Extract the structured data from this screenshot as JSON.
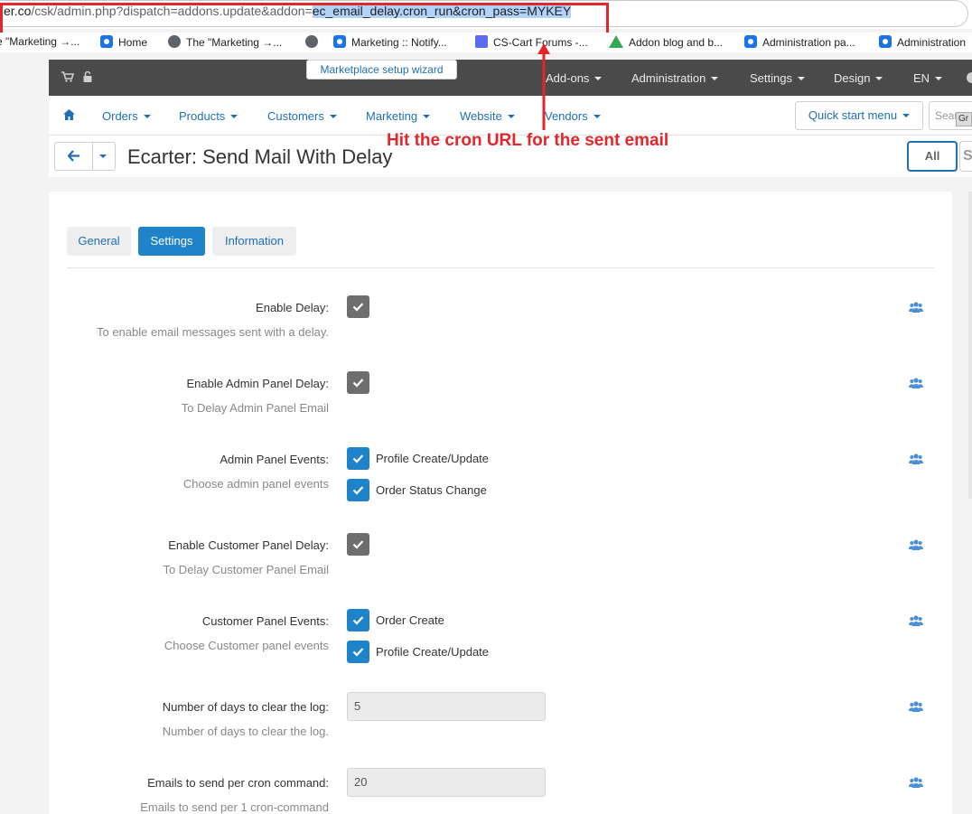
{
  "browser": {
    "url_prefix": "er.co",
    "url_path": "/csk/admin.php?dispatch=addons.update&addon=",
    "url_selected": "ec_email_delay.cron_run&cron_pass=MYKEY",
    "bookmarks": [
      {
        "label": "e \"Marketing →...",
        "icon": "none"
      },
      {
        "label": "Home",
        "icon": "gear-icon"
      },
      {
        "label": "The \"Marketing →...",
        "icon": "globe-icon"
      },
      {
        "label": "",
        "icon": "globe-icon"
      },
      {
        "label": "Marketing :: Notify...",
        "icon": "gear-icon"
      },
      {
        "label": "CS-Cart Forums -...",
        "icon": "square-icon"
      },
      {
        "label": "Addon blog and b...",
        "icon": "drive-icon"
      },
      {
        "label": "Administration pa...",
        "icon": "gear-icon"
      },
      {
        "label": "Administration",
        "icon": "gear-icon"
      }
    ]
  },
  "topbar": {
    "tooltip": "Marketplace setup wizard",
    "menus": [
      "Add-ons",
      "Administration",
      "Settings",
      "Design",
      "EN"
    ]
  },
  "nav": {
    "items": [
      "Orders",
      "Products",
      "Customers",
      "Marketing",
      "Website",
      "Vendors"
    ],
    "quick_start": "Quick start menu",
    "search_placeholder": "Sear",
    "tooltip_fragment": "Gr"
  },
  "title": {
    "text": "Ecarter: Send Mail With Delay",
    "all_button": "All",
    "edge_fragment": "S ("
  },
  "annotation": {
    "text": "Hit the cron URL for the sent email",
    "color": "#e3262b"
  },
  "tabs": [
    {
      "label": "General",
      "active": false
    },
    {
      "label": "Settings",
      "active": true
    },
    {
      "label": "Information",
      "active": false
    }
  ],
  "settings": [
    {
      "label": "Enable Delay:",
      "help": "To enable email messages sent with a delay.",
      "type": "checkbox",
      "checked": true,
      "style": "gray"
    },
    {
      "label": "Enable Admin Panel Delay:",
      "help": "To Delay Admin Panel Email",
      "type": "checkbox",
      "checked": true,
      "style": "gray"
    },
    {
      "label": "Admin Panel Events:",
      "help": "Choose admin panel events",
      "type": "multi",
      "options": [
        "Profile Create/Update",
        "Order Status Change"
      ]
    },
    {
      "label": "Enable Customer Panel Delay:",
      "help": "To Delay Customer Panel Email",
      "type": "checkbox",
      "checked": true,
      "style": "gray"
    },
    {
      "label": "Customer Panel Events:",
      "help": "Choose Customer panel events",
      "type": "multi",
      "options": [
        "Order Create",
        "Profile Create/Update"
      ]
    },
    {
      "label": "Number of days to clear the log:",
      "help": "Number of days to clear the log.",
      "type": "text",
      "value": "5"
    },
    {
      "label": "Emails to send per cron command:",
      "help": "Emails to send per 1 cron-command",
      "type": "text",
      "value": "20"
    }
  ],
  "colors": {
    "accent": "#1f83c9",
    "link": "#1f6fb5",
    "topbar": "#4a4a4a",
    "checkbox_gray": "#6e6e6e"
  }
}
